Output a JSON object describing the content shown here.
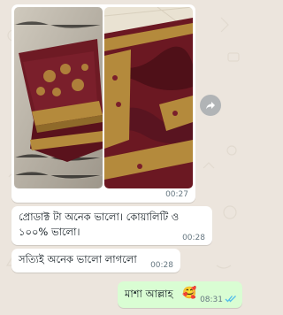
{
  "album": {
    "time": "00:27",
    "photos": [
      {
        "icon": "saree-folded-photo"
      },
      {
        "icon": "saree-draped-photo"
      }
    ]
  },
  "forward": {
    "icon": "forward-arrow-icon"
  },
  "messages": [
    {
      "line1": "প্রোডাক্ট টা অনেক ভালো। কোয়ালিটি ও",
      "line2": "১০০% ভালো।",
      "time": "00:28"
    },
    {
      "text": "সত্যিই অনেক ভালো লাগলো",
      "time": "00:28"
    }
  ],
  "outgoing": {
    "text": "মাশা আল্লাহ",
    "emoji": "🥰",
    "time": "08:31",
    "status": "read",
    "status_icon": "double-check-icon",
    "status_color": "#53bdeb"
  },
  "colors": {
    "wallpaper": "#ece5dd",
    "incoming": "#ffffff",
    "outgoing": "#d9fdd3",
    "maroon": "#6e1a24",
    "gold": "#b48a3c"
  }
}
